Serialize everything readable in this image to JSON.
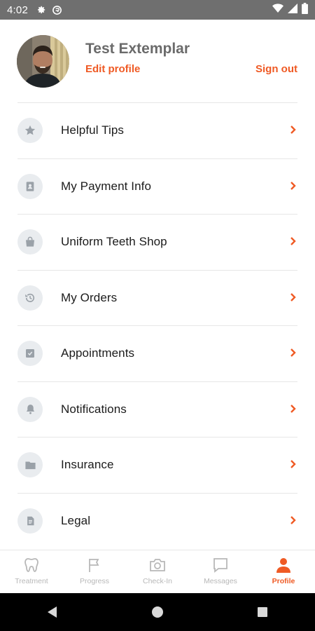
{
  "status_bar": {
    "time": "4:02",
    "icons": [
      "gear-icon",
      "sync-icon",
      "wifi-icon",
      "signal-icon",
      "battery-icon"
    ]
  },
  "profile": {
    "name": "Test Extemplar",
    "edit_label": "Edit profile",
    "signout_label": "Sign out"
  },
  "menu": {
    "items": [
      {
        "label": "Helpful Tips",
        "icon": "star-icon"
      },
      {
        "label": "My Payment Info",
        "icon": "contact-card-icon"
      },
      {
        "label": "Uniform Teeth Shop",
        "icon": "shopping-bag-icon"
      },
      {
        "label": "My Orders",
        "icon": "history-icon"
      },
      {
        "label": "Appointments",
        "icon": "calendar-check-icon"
      },
      {
        "label": "Notifications",
        "icon": "bell-icon"
      },
      {
        "label": "Insurance",
        "icon": "folder-icon"
      },
      {
        "label": "Legal",
        "icon": "document-icon"
      }
    ]
  },
  "tabs": [
    {
      "label": "Treatment",
      "icon": "tooth-icon",
      "active": false
    },
    {
      "label": "Progress",
      "icon": "flag-icon",
      "active": false
    },
    {
      "label": "Check-In",
      "icon": "camera-icon",
      "active": false
    },
    {
      "label": "Messages",
      "icon": "chat-bubble-icon",
      "active": false
    },
    {
      "label": "Profile",
      "icon": "person-icon",
      "active": true
    }
  ],
  "colors": {
    "accent": "#ef5a24",
    "status_bar": "#6f6f6f",
    "icon_bg": "#e9ecef",
    "icon_fg": "#9aa1a8",
    "tab_inactive": "#b8b8b8"
  }
}
